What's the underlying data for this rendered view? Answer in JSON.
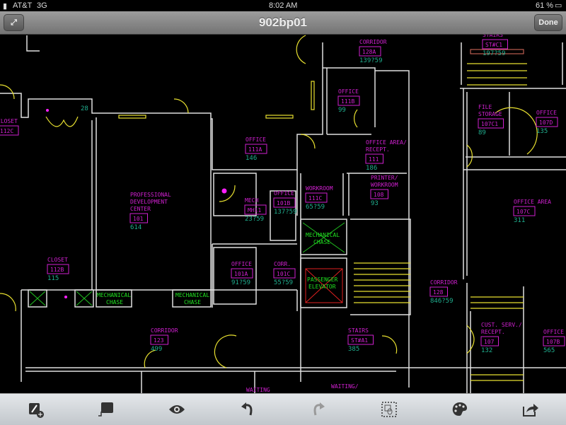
{
  "status_bar": {
    "carrier": "AT&T",
    "network": "3G",
    "time": "8:02 AM",
    "battery": "61 %"
  },
  "nav_bar": {
    "title": "902bp01",
    "done_label": "Done"
  },
  "colors": {
    "wall": "#e0e0e0",
    "door": "#e8e030",
    "room_name": "#d020d0",
    "area": "#20b090",
    "chase": "#20e020",
    "elevator": "#e02020"
  },
  "rooms": [
    {
      "name": [
        "CORRIDOR"
      ],
      "number": "128A",
      "area": "139?59"
    },
    {
      "name": [
        "STAIRS"
      ],
      "number": "ST#C1",
      "area": "197?59"
    },
    {
      "name": [
        "OFFICE"
      ],
      "number": "111B",
      "area": "99"
    },
    {
      "name": [
        "CLOSET"
      ],
      "number": "112C",
      "area": ""
    },
    {
      "name": [
        "FILE",
        "STORAGE"
      ],
      "number": "107C1",
      "area": "89"
    },
    {
      "name": [
        "OFFICE"
      ],
      "number": "107D",
      "area": "135"
    },
    {
      "name": [
        "OFFICE"
      ],
      "number": "111A",
      "area": "146"
    },
    {
      "name": [
        "OFFICE AREA/",
        "RECEPT."
      ],
      "number": "111",
      "area": "186"
    },
    {
      "name": [
        "PROFESSIONAL",
        "DEVELOPMENT",
        "CENTER"
      ],
      "number": "101",
      "area": "614"
    },
    {
      "name": [
        "WORKROOM"
      ],
      "number": "111C",
      "area": "65?59"
    },
    {
      "name": [
        "PRINTER/",
        "WORKROOM"
      ],
      "number": "108",
      "area": "93"
    },
    {
      "name": [
        "MECH"
      ],
      "number": "MH11",
      "area": "23?59"
    },
    {
      "name": [
        "OFFICE"
      ],
      "number": "101B",
      "area": "137?59"
    },
    {
      "name": [
        "OFFICE AREA"
      ],
      "number": "107C",
      "area": "311"
    },
    {
      "name": [
        "CLOSET"
      ],
      "number": "112B",
      "area": "115"
    },
    {
      "name": [
        "OFFICE"
      ],
      "number": "101A",
      "area": "91?59"
    },
    {
      "name": [
        "CORR."
      ],
      "number": "101C",
      "area": "55?59"
    },
    {
      "name": [
        "CORRIDOR"
      ],
      "number": "128",
      "area": "846?59"
    },
    {
      "name": [
        "CORRIDOR"
      ],
      "number": "123",
      "area": "499"
    },
    {
      "name": [
        "STAIRS"
      ],
      "number": "ST#A1",
      "area": "385"
    },
    {
      "name": [
        "CUST. SERV./",
        "RECEPT."
      ],
      "number": "107",
      "area": "132"
    },
    {
      "name": [
        "OFFICE AREA"
      ],
      "number": "107B",
      "area": "565"
    }
  ],
  "extra_labels": {
    "waiting": "WAITING",
    "waiting2": "WAITING/",
    "area_28": "28"
  },
  "chases": [
    {
      "line1": "MECHANICAL",
      "line2": "CHASE"
    },
    {
      "line1": "MECHANICAL",
      "line2": "CHASE"
    },
    {
      "line1": "MECHANICAL",
      "line2": "CHASE"
    },
    {
      "line1": "PASSENGER",
      "line2": "ELEVATOR"
    }
  ],
  "toolbar": [
    "annotate-icon",
    "comment-icon",
    "view-icon",
    "undo-icon",
    "redo-icon",
    "select-icon",
    "palette-icon",
    "share-icon"
  ]
}
